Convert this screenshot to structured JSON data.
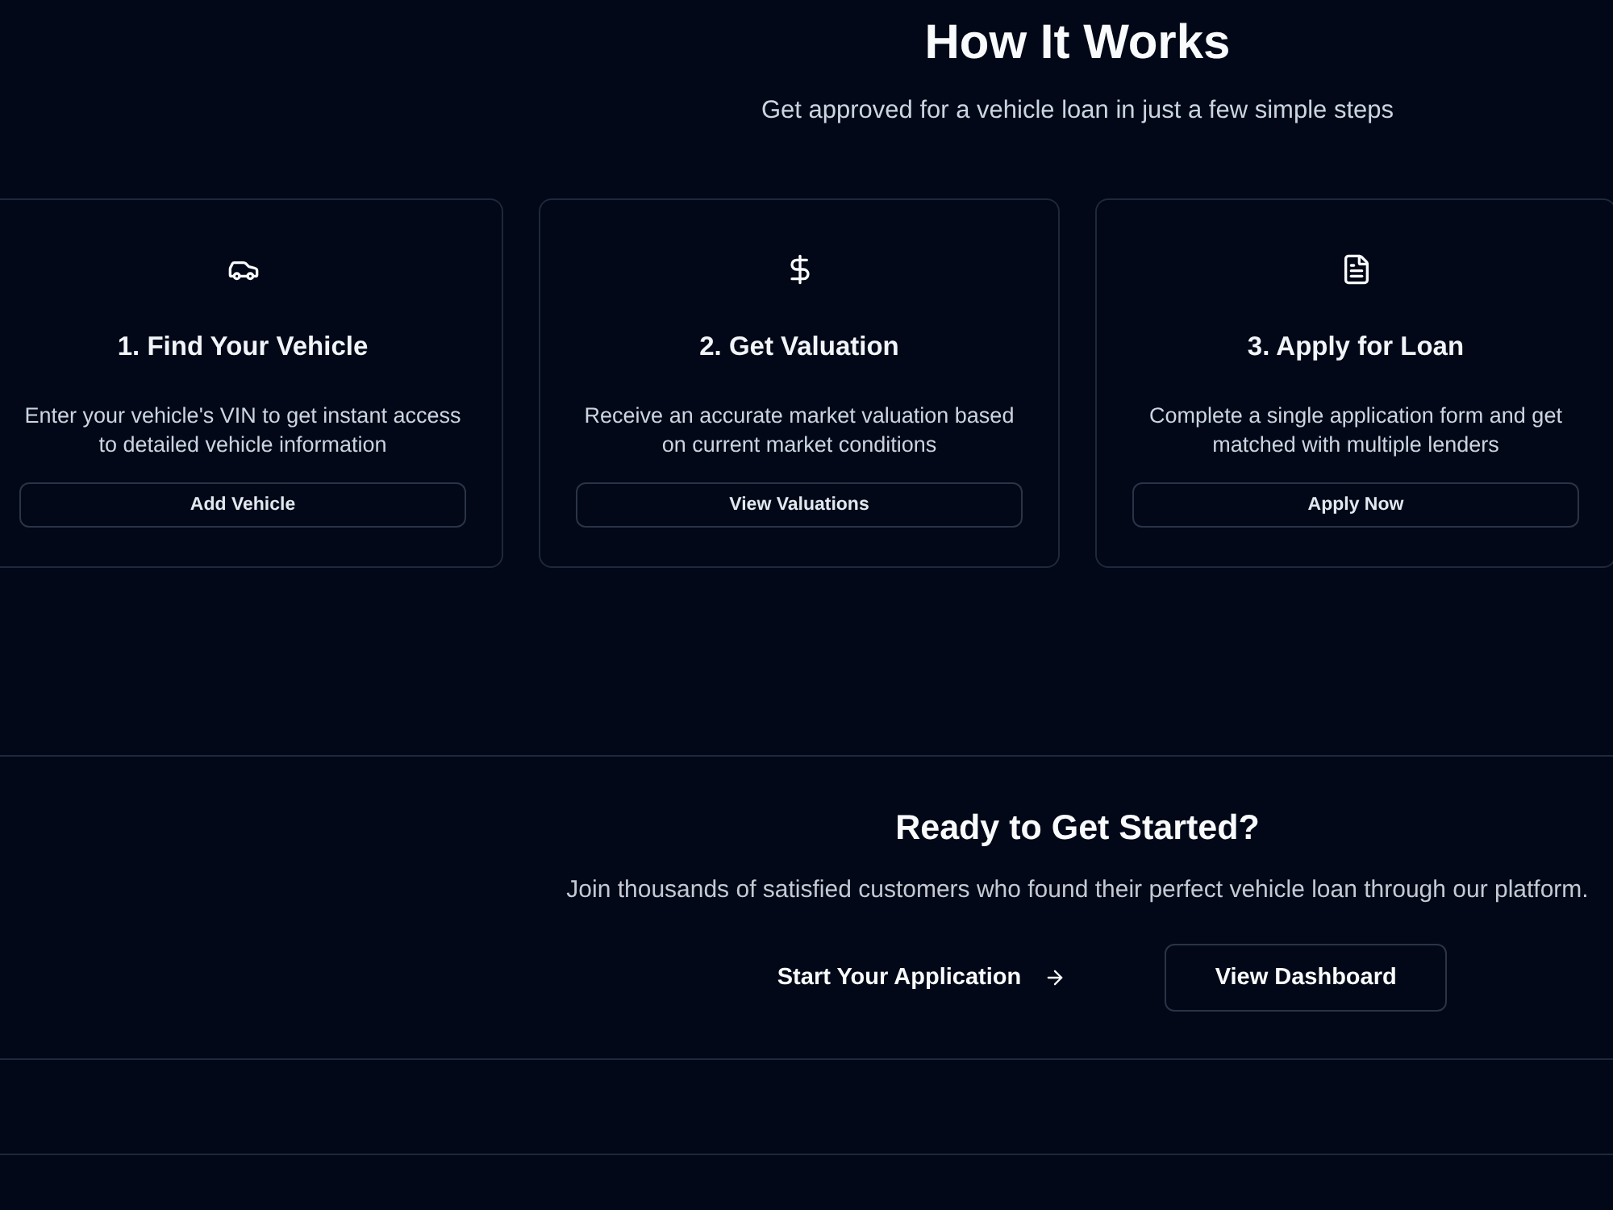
{
  "hero": {
    "title": "How It Works",
    "subtitle": "Get approved for a vehicle loan in just a few simple steps"
  },
  "steps": [
    {
      "kind": "car",
      "title": "1. Find Your Vehicle",
      "description": "Enter your vehicle's VIN to get instant access to detailed vehicle information",
      "button": "Add Vehicle"
    },
    {
      "kind": "dollar",
      "title": "2. Get Valuation",
      "description": "Receive an accurate market valuation based on current market conditions",
      "button": "View Valuations"
    },
    {
      "kind": "document",
      "title": "3. Apply for Loan",
      "description": "Complete a single application form and get matched with multiple lenders",
      "button": "Apply Now"
    }
  ],
  "cta": {
    "title": "Ready to Get Started?",
    "text": "Join thousands of satisfied customers who found their perfect vehicle loan through our platform.",
    "buttons": [
      {
        "kind": "ghost",
        "label": "Start Your Application"
      },
      {
        "kind": "outline",
        "label": "View Dashboard"
      }
    ]
  }
}
